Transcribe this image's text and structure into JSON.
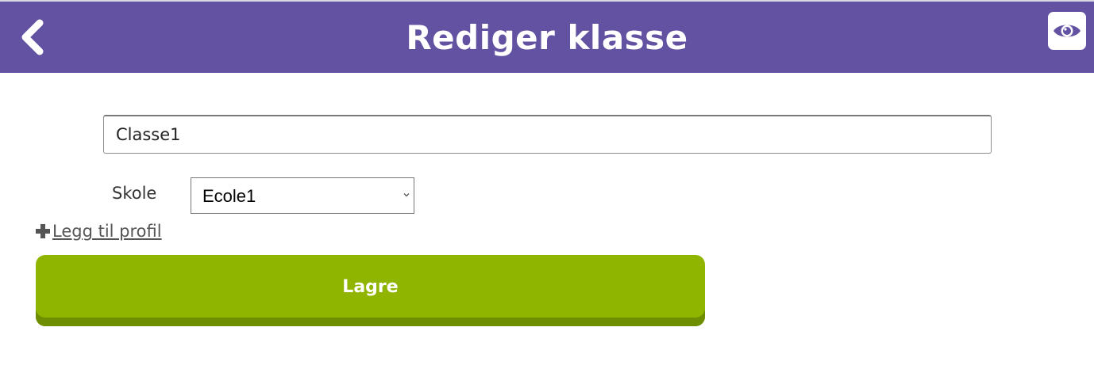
{
  "header": {
    "title": "Rediger klasse",
    "back_icon": "chevron-left-icon",
    "preview_icon": "eye-icon",
    "background_color": "#6352a2"
  },
  "form": {
    "class_name_value": "Classe1",
    "school_label": "Skole",
    "school_selected": "Ecole1",
    "add_profile_label": " Legg til profil",
    "save_label": "Lagre",
    "save_color": "#90b500"
  }
}
